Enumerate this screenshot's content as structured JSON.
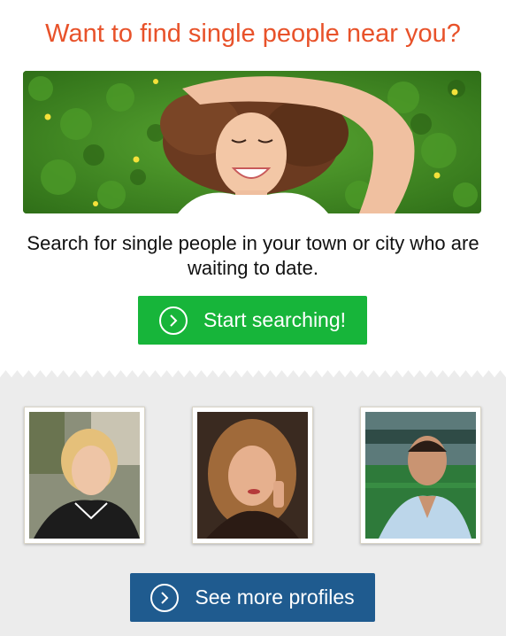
{
  "headline": "Want to find single people near you?",
  "hero": {
    "image": "woman lying in grass smiling"
  },
  "subtext": "Search for single people in your town or city who are waiting to date.",
  "start_button": {
    "label": "Start searching!",
    "icon": "chevron-right-circle-icon"
  },
  "profiles": [
    {
      "image": "blonde woman outdoors"
    },
    {
      "image": "woman with long hair on phone"
    },
    {
      "image": "man in stadium"
    }
  ],
  "more_button": {
    "label": "See more profiles",
    "icon": "chevron-right-circle-icon"
  },
  "colors": {
    "headline": "#e8522a",
    "start_button": "#17b53a",
    "more_button": "#1f5b8f",
    "gray_background": "#ececec"
  }
}
